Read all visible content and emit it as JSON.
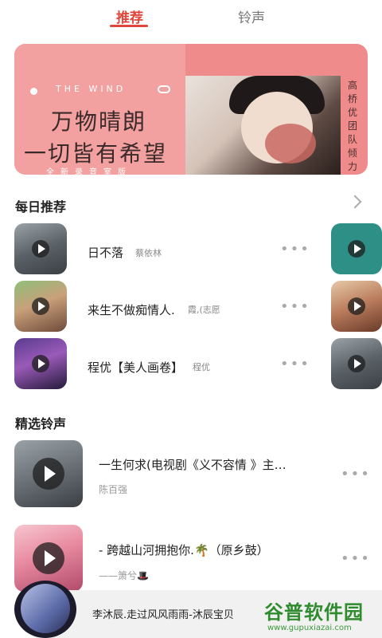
{
  "tabs": [
    {
      "label": "推荐",
      "active": true
    },
    {
      "label": "铃声",
      "active": false
    }
  ],
  "banner": {
    "tag": "THE WIND",
    "line1": "万物晴朗",
    "line2": "一切皆有希望",
    "sub": "全新录音室版",
    "side_text": "高桥优团队倾力打造"
  },
  "daily": {
    "title": "每日推荐",
    "items": [
      {
        "title": "日不落",
        "artist": "蔡依林"
      },
      {
        "title": "来生不做痴情人.",
        "artist": "霞,(志愿"
      },
      {
        "title": "程优【美人画卷】",
        "artist": "程优"
      }
    ]
  },
  "ringtones": {
    "title": "精选铃声",
    "items": [
      {
        "title": "一生何求(电视剧《义不容情 》主…",
        "artist": "陈百强"
      },
      {
        "title": "- 跨越山河拥抱你.🌴（原乡鼓）",
        "artist": "——箫兮🎩"
      }
    ]
  },
  "player": {
    "now_playing": "李沐辰.走过风风雨雨-沐辰宝贝"
  },
  "watermark": {
    "name": "谷普软件园",
    "url": "www.gupuxiazai.com"
  },
  "colors": {
    "accent": "#e0463b",
    "banner_bg": "#f08b8b"
  }
}
